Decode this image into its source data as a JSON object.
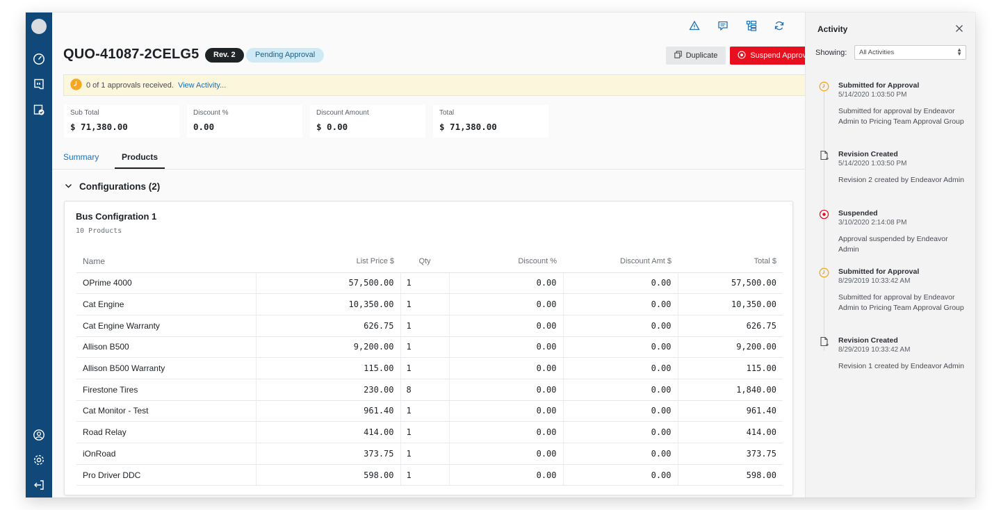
{
  "toolbar": {
    "icons": [
      "warning-icon",
      "comment-icon",
      "layout-icon",
      "refresh-icon"
    ]
  },
  "quote": {
    "id": "QUO-41087-2CELG5",
    "revision": "Rev. 2",
    "status": "Pending Approval",
    "duplicate_label": "Duplicate",
    "suspend_label": "Suspend Approval"
  },
  "approval": {
    "message": "0 of 1 approvals received.",
    "link": "View Activity..."
  },
  "stats": [
    {
      "label": "Sub Total",
      "value": "$ 71,380.00"
    },
    {
      "label": "Discount %",
      "value": "0.00"
    },
    {
      "label": "Discount Amount",
      "value": "$ 0.00"
    },
    {
      "label": "Total",
      "value": "$ 71,380.00"
    }
  ],
  "tabs": [
    {
      "label": "Summary"
    },
    {
      "label": "Products"
    }
  ],
  "configurations": {
    "heading": "Configurations (2)",
    "card": {
      "title": "Bus Configration 1",
      "subtitle": "10 Products",
      "columns": [
        "Name",
        "List Price $",
        "Qty",
        "Discount %",
        "Discount Amt $",
        "Total $"
      ],
      "rows": [
        [
          "OPrime 4000",
          "57,500.00",
          "1",
          "0.00",
          "0.00",
          "57,500.00"
        ],
        [
          "Cat Engine",
          "10,350.00",
          "1",
          "0.00",
          "0.00",
          "10,350.00"
        ],
        [
          "Cat Engine Warranty",
          "626.75",
          "1",
          "0.00",
          "0.00",
          "626.75"
        ],
        [
          "Allison B500",
          "9,200.00",
          "1",
          "0.00",
          "0.00",
          "9,200.00"
        ],
        [
          "Allison B500 Warranty",
          "115.00",
          "1",
          "0.00",
          "0.00",
          "115.00"
        ],
        [
          "Firestone Tires",
          "230.00",
          "8",
          "0.00",
          "0.00",
          "1,840.00"
        ],
        [
          "Cat Monitor - Test",
          "961.40",
          "1",
          "0.00",
          "0.00",
          "961.40"
        ],
        [
          "Road Relay",
          "414.00",
          "1",
          "0.00",
          "0.00",
          "414.00"
        ],
        [
          "iOnRoad",
          "373.75",
          "1",
          "0.00",
          "0.00",
          "373.75"
        ],
        [
          "Pro Driver DDC",
          "598.00",
          "1",
          "0.00",
          "0.00",
          "598.00"
        ]
      ]
    }
  },
  "activity": {
    "title": "Activity",
    "showing_label": "Showing:",
    "filter_value": "All Activities",
    "items": [
      {
        "icon": "clock-icon",
        "title": "Submitted for Approval",
        "date": "5/14/2020 1:03:50 PM",
        "desc": "Submitted for approval by Endeavor Admin to Pricing Team Approval Group"
      },
      {
        "icon": "document-add-icon",
        "title": "Revision Created",
        "date": "5/14/2020 1:03:50 PM",
        "desc": "Revision 2 created by Endeavor Admin"
      },
      {
        "icon": "stop-icon",
        "title": "Suspended",
        "date": "3/10/2020 2:14:08 PM",
        "desc": "Approval suspended by Endeavor Admin"
      },
      {
        "icon": "clock-icon",
        "title": "Submitted for Approval",
        "date": "8/29/2019 10:33:42 AM",
        "desc": "Submitted for approval by Endeavor Admin to Pricing Team Approval Group"
      },
      {
        "icon": "document-add-icon",
        "title": "Revision Created",
        "date": "8/29/2019 10:33:42 AM",
        "desc": "Revision 1 created by Endeavor Admin"
      }
    ]
  },
  "colors": {
    "rail": "#11487a",
    "accent_link": "#1f6fb5",
    "danger": "#e8101f",
    "pending_bg": "#cfeaf5",
    "warning": "#f5a623"
  }
}
